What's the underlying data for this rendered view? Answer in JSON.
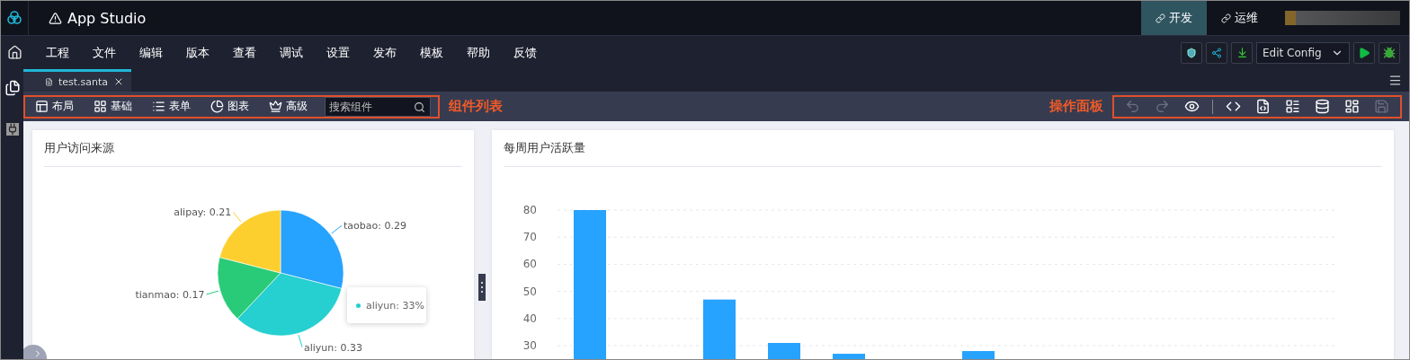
{
  "app": {
    "title": "App Studio"
  },
  "modes": [
    {
      "label": "开发",
      "selected": true
    },
    {
      "label": "运维",
      "selected": false
    }
  ],
  "menu": [
    "工程",
    "文件",
    "编辑",
    "版本",
    "查看",
    "调试",
    "设置",
    "发布",
    "模板",
    "帮助",
    "反馈"
  ],
  "config_select": {
    "value": "Edit Config"
  },
  "editor_tabs": [
    {
      "label": "test.santa",
      "selected": true
    }
  ],
  "components": [
    {
      "label": "布局",
      "kind": "layout"
    },
    {
      "label": "基础",
      "kind": "basic"
    },
    {
      "label": "表单",
      "kind": "form"
    },
    {
      "label": "图表",
      "kind": "chart"
    },
    {
      "label": "高级",
      "kind": "advanced"
    }
  ],
  "component_search": {
    "placeholder": "搜索组件"
  },
  "annotations": {
    "components": "组件列表",
    "actions": "操作面板"
  },
  "actions": [
    {
      "kind": "undo",
      "disabled": true
    },
    {
      "kind": "redo",
      "disabled": true
    },
    {
      "kind": "preview",
      "disabled": false
    },
    {
      "kind": "code",
      "disabled": false
    },
    {
      "kind": "css",
      "disabled": false
    },
    {
      "kind": "form",
      "disabled": false
    },
    {
      "kind": "data",
      "disabled": false
    },
    {
      "kind": "layout",
      "disabled": false
    },
    {
      "kind": "save",
      "disabled": true
    }
  ],
  "cards": [
    {
      "title": "用户访问来源",
      "chart_data": {
        "type": "pie",
        "values": [
          0.29,
          0.33,
          0.17,
          0.21
        ],
        "value_labels": [
          "taobao: 0.29",
          "aliyun: 0.33",
          "tianmao: 0.17",
          "alipay: 0.21"
        ]
      },
      "tooltip": {
        "text": "aliyun: 33%",
        "color": "#26cfd0"
      }
    },
    {
      "title": "每周用户活跃量",
      "chart_data": {
        "type": "bar",
        "values": [
          80,
          null,
          47,
          31,
          27,
          null,
          28,
          null,
          null,
          null,
          null,
          null
        ],
        "grid": true,
        "ylim": [
          25,
          80
        ],
        "yticks": [
          30,
          40,
          50,
          60,
          70,
          80
        ]
      }
    }
  ]
}
